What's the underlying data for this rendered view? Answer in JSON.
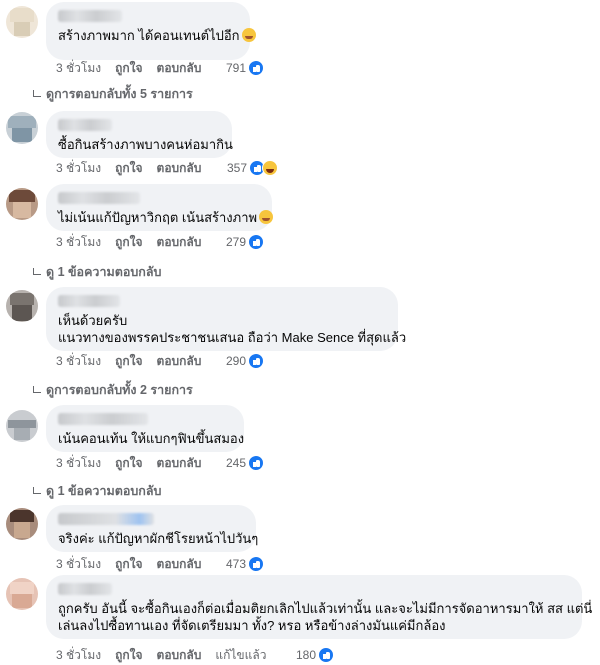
{
  "comments": [
    {
      "text_lines": [
        "สร้างภาพมาก ได้คอนเทนต์ไปอีก"
      ],
      "emoji": "laughing-emoji",
      "time": "3 ชั่วโมง",
      "like": "ถูกใจ",
      "reply": "ตอบกลับ",
      "reaction_count": "791",
      "reactions": [
        "like"
      ],
      "view_replies": "ดูการตอบกลับทั้ง 5 รายการ"
    },
    {
      "text_lines": [
        "ซื้อกินสร้างภาพบางคนห่อมากิน"
      ],
      "time": "3 ชั่วโมง",
      "like": "ถูกใจ",
      "reply": "ตอบกลับ",
      "reaction_count": "357",
      "reactions": [
        "like",
        "haha"
      ]
    },
    {
      "text_lines": [
        "ไม่เน้นแก้ปัญหาวิกฤต เน้นสร้างภาพ"
      ],
      "emoji": "laughing-emoji",
      "time": "3 ชั่วโมง",
      "like": "ถูกใจ",
      "reply": "ตอบกลับ",
      "reaction_count": "279",
      "reactions": [
        "like"
      ],
      "view_replies": "ดู 1 ข้อความตอบกลับ"
    },
    {
      "text_lines": [
        "เห็นด้วยครับ",
        "แนวทางของพรรคประชาชนเสนอ ถือว่า Make Sence ที่สุดแล้ว"
      ],
      "time": "3 ชั่วโมง",
      "like": "ถูกใจ",
      "reply": "ตอบกลับ",
      "reaction_count": "290",
      "reactions": [
        "like"
      ],
      "view_replies": "ดูการตอบกลับทั้ง 2 รายการ"
    },
    {
      "text_lines": [
        "เน้นคอนเท้น ให้แบกๆฟินขึ้นสมอง"
      ],
      "time": "3 ชั่วโมง",
      "like": "ถูกใจ",
      "reply": "ตอบกลับ",
      "reaction_count": "245",
      "reactions": [
        "like"
      ],
      "view_replies": "ดู 1 ข้อความตอบกลับ"
    },
    {
      "text_lines": [
        "จริงค่ะ แก้ปัญหาผักชีโรยหน้าไปวันๆ"
      ],
      "time": "3 ชั่วโมง",
      "like": "ถูกใจ",
      "reply": "ตอบกลับ",
      "reaction_count": "473",
      "reactions": [
        "like"
      ]
    },
    {
      "text_lines": [
        "ถูกครับ อันนี้ จะซื้อกินเองก็ต่อเมื่อมติยกเลิกไปแล้วเท่านั้น และจะไม่มีการจัดอาหารมาให้ สส แต่นี่",
        "เล่นลงไปซื้อทานเอง ที่จัดเตรียมมา ทั้ง? หรอ หรือข้างล่างมันแค่มีกล้อง"
      ],
      "time": "3 ชั่วโมง",
      "like": "ถูกใจ",
      "reply": "ตอบกลับ",
      "edited": "แก้ไขแล้ว",
      "reaction_count": "180",
      "reactions": [
        "like"
      ]
    }
  ],
  "colors": {
    "bubble": "#f0f2f5",
    "meta": "#65676b",
    "like_blue": "#1877f2"
  }
}
